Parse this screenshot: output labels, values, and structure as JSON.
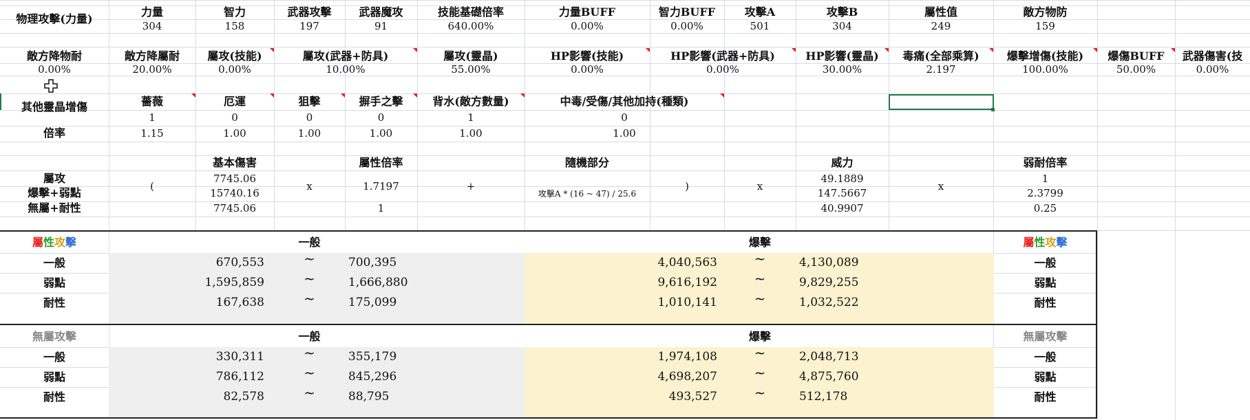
{
  "row1": {
    "label": "物理攻擊(力量)",
    "headers": [
      "力量",
      "智力",
      "武器攻擊",
      "武器魔攻",
      "技能基礎倍率",
      "力量BUFF",
      "智力BUFF",
      "攻擊A",
      "攻擊B",
      "屬性值",
      "敵方物防"
    ],
    "values": [
      "304",
      "158",
      "197",
      "91",
      "640.00%",
      "0.00%",
      "0.00%",
      "501",
      "304",
      "249",
      "159"
    ]
  },
  "row2": {
    "headers": [
      "敵方降物耐",
      "敵方降屬耐",
      "屬攻(技能)",
      "屬攻(武器+防具)",
      "屬攻(靈晶)",
      "HP影響(技能)",
      "HP影響(武器+防具)",
      "HP影響(靈晶)",
      "毒痛(全部乘算)",
      "爆擊增傷(技能)",
      "爆傷BUFF",
      "武器傷害(技"
    ],
    "values": [
      "0.00%",
      "20.00%",
      "0.00%",
      "10.00%",
      "55.00%",
      "0.00%",
      "0.00%",
      "30.00%",
      "2.197",
      "100.00%",
      "50.00%",
      "0.00%"
    ]
  },
  "row3": {
    "label": "其他靈晶增傷",
    "rate_label": "倍率",
    "headers": [
      "薔薇",
      "厄運",
      "狙擊",
      "摒手之擊",
      "背水(敵方數量)",
      "中毒/受傷/其他加持(種類)"
    ],
    "counts": [
      "1",
      "0",
      "0",
      "0",
      "1",
      "0"
    ],
    "rates": [
      "1.15",
      "1.00",
      "1.00",
      "1.00",
      "1.00",
      "1.00"
    ]
  },
  "formula": {
    "row_labels": [
      "屬攻",
      "爆擊+弱點",
      "無屬+耐性"
    ],
    "open_paren": "(",
    "base_header": "基本傷害",
    "base_values": [
      "7745.06",
      "15740.16",
      "7745.06"
    ],
    "times": "x",
    "attr_header": "屬性倍率",
    "attr_values": [
      "1.7197",
      "1"
    ],
    "plus": "+",
    "random_header": "隨機部分",
    "random_formula": "攻擊A * (16 ~ 47) / 25.6",
    "close_paren": ")",
    "power_header": "威力",
    "power_values": [
      "49.1889",
      "147.5667",
      "40.9907"
    ],
    "weak_header": "弱耐倍率",
    "weak_values": [
      "1",
      "2.3799",
      "0.25"
    ]
  },
  "table_attr": {
    "title_chars": [
      "屬",
      "性",
      "攻",
      "擊"
    ],
    "title_colors": [
      "#e8231f",
      "#2a9d2a",
      "#d4a017",
      "#2a6fd6"
    ],
    "col_normal": "一般",
    "col_crit": "爆擊",
    "rows": [
      {
        "label": "一般",
        "n_min": "670,553",
        "n_max": "700,395",
        "c_min": "4,040,563",
        "c_max": "4,130,089"
      },
      {
        "label": "弱點",
        "n_min": "1,595,859",
        "n_max": "1,666,880",
        "c_min": "9,616,192",
        "c_max": "9,829,255"
      },
      {
        "label": "耐性",
        "n_min": "167,638",
        "n_max": "175,099",
        "c_min": "1,010,141",
        "c_max": "1,032,522"
      }
    ]
  },
  "table_none": {
    "title": "無屬攻擊",
    "col_normal": "一般",
    "col_crit": "爆擊",
    "rows": [
      {
        "label": "一般",
        "n_min": "330,311",
        "n_max": "355,179",
        "c_min": "1,974,108",
        "c_max": "2,048,713"
      },
      {
        "label": "弱點",
        "n_min": "786,112",
        "n_max": "845,296",
        "c_min": "4,698,207",
        "c_max": "4,875,760"
      },
      {
        "label": "耐性",
        "n_min": "82,578",
        "n_max": "88,795",
        "c_min": "493,527",
        "c_max": "512,178"
      }
    ]
  },
  "tilde": "~",
  "colors": {
    "grid": "#d8dbe6",
    "gray_fill": "#efefef",
    "crit_fill": "#fdf2cf",
    "select": "#1e7b45",
    "comment": "#e02020",
    "muted": "#888888"
  }
}
